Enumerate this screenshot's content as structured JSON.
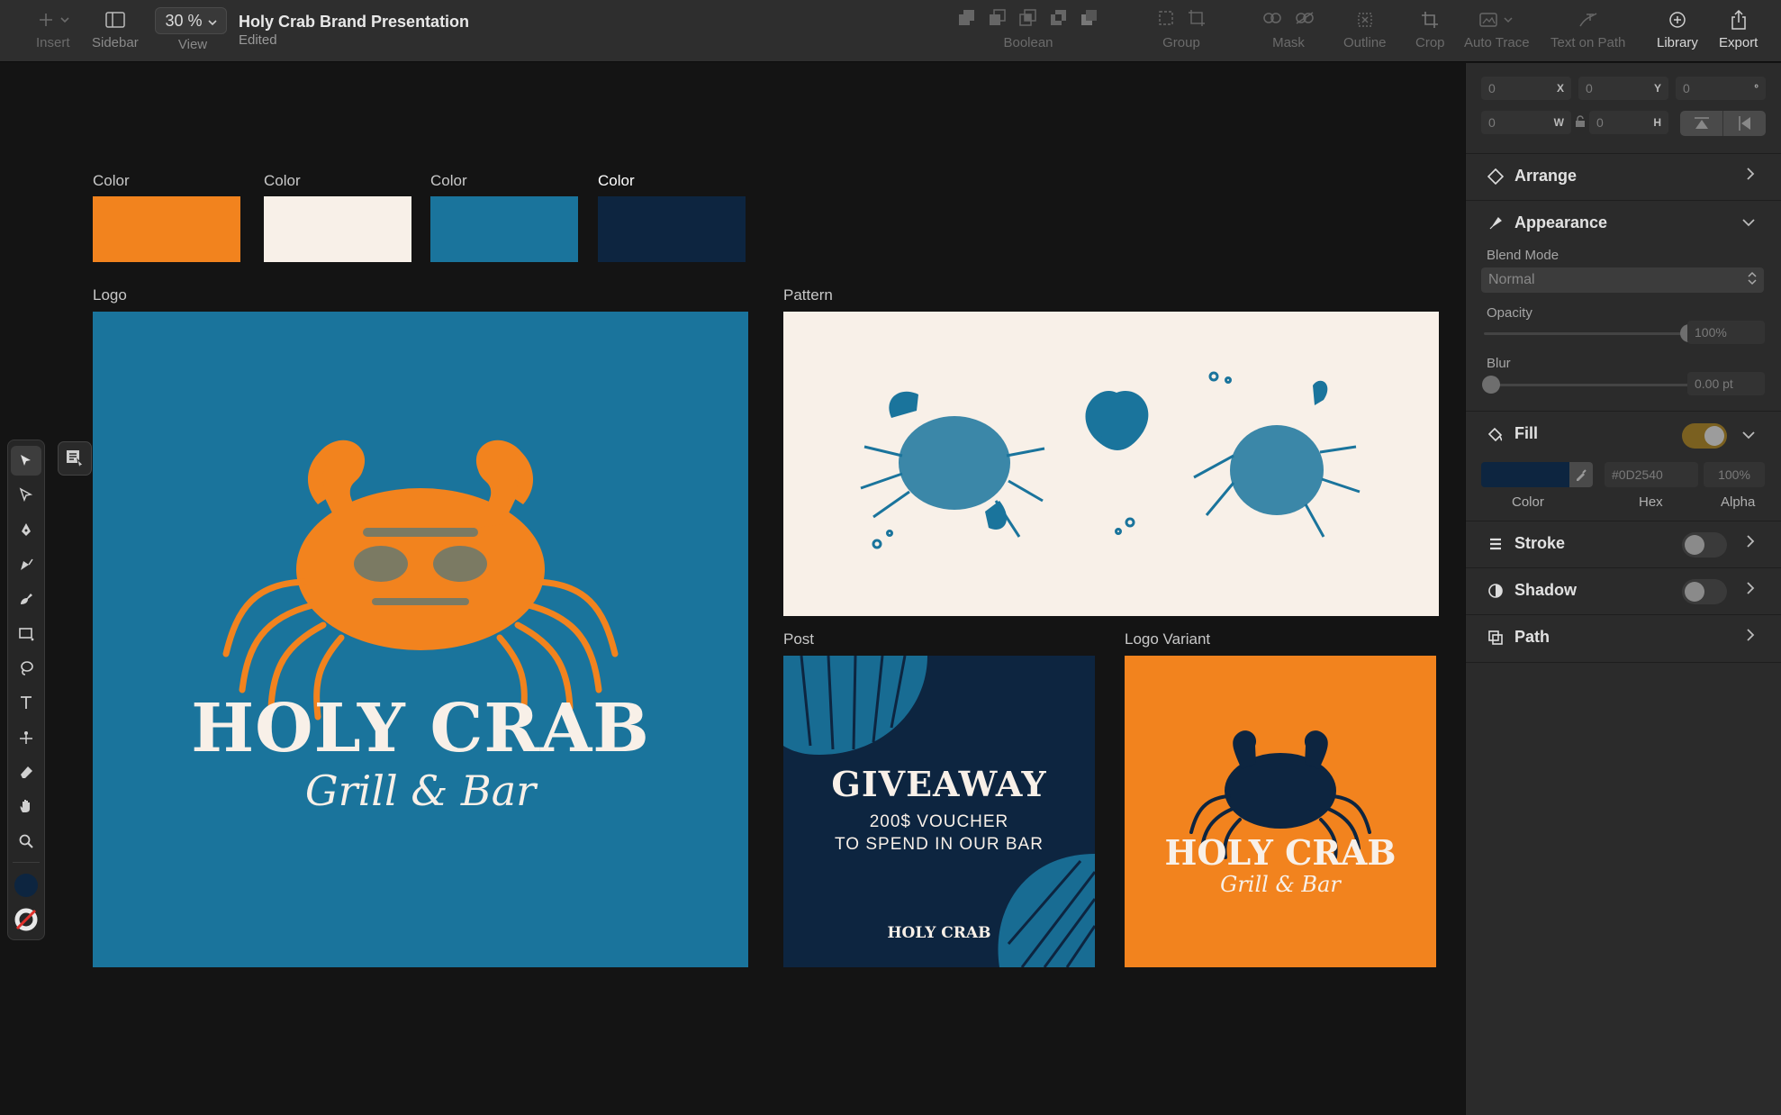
{
  "toolbar": {
    "insert": "Insert",
    "sidebar": "Sidebar",
    "zoom": "30 %",
    "view": "View",
    "doc_title": "Holy Crab Brand Presentation",
    "doc_status": "Edited",
    "boolean": "Boolean",
    "group": "Group",
    "mask": "Mask",
    "outline": "Outline",
    "crop": "Crop",
    "auto_trace": "Auto Trace",
    "text_on_path": "Text on Path",
    "library": "Library",
    "export": "Export"
  },
  "canvas": {
    "swatches": [
      {
        "label": "Color",
        "color": "#F2831E"
      },
      {
        "label": "Color",
        "color": "#F8F0E8"
      },
      {
        "label": "Color",
        "color": "#1A749C"
      },
      {
        "label": "Color",
        "color": "#0D2540"
      }
    ],
    "artboards": {
      "logo": {
        "label": "Logo",
        "title": "HOLY CRAB",
        "subtitle": "Grill & Bar"
      },
      "pattern": {
        "label": "Pattern"
      },
      "post": {
        "label": "Post",
        "headline": "GIVEAWAY",
        "line1": "200$ VOUCHER",
        "line2": "TO SPEND IN OUR BAR",
        "brand": "HOLY CRAB"
      },
      "logo_variant": {
        "label": "Logo Variant",
        "title": "HOLY CRAB",
        "subtitle": "Grill & Bar"
      }
    },
    "help": "?"
  },
  "inspector": {
    "x": "0",
    "x_label": "X",
    "y": "0",
    "y_label": "Y",
    "rotation": "0",
    "rotation_label": "°",
    "w": "0",
    "w_label": "W",
    "h": "0",
    "h_label": "H",
    "arrange": "Arrange",
    "appearance": "Appearance",
    "blend_mode_label": "Blend Mode",
    "blend_mode": "Normal",
    "opacity_label": "Opacity",
    "opacity": "100%",
    "blur_label": "Blur",
    "blur": "0.00 pt",
    "fill": "Fill",
    "fill_hex": "#0D2540",
    "fill_alpha": "100%",
    "color_label": "Color",
    "hex_label": "Hex",
    "alpha_label": "Alpha",
    "stroke": "Stroke",
    "shadow": "Shadow",
    "path": "Path"
  }
}
